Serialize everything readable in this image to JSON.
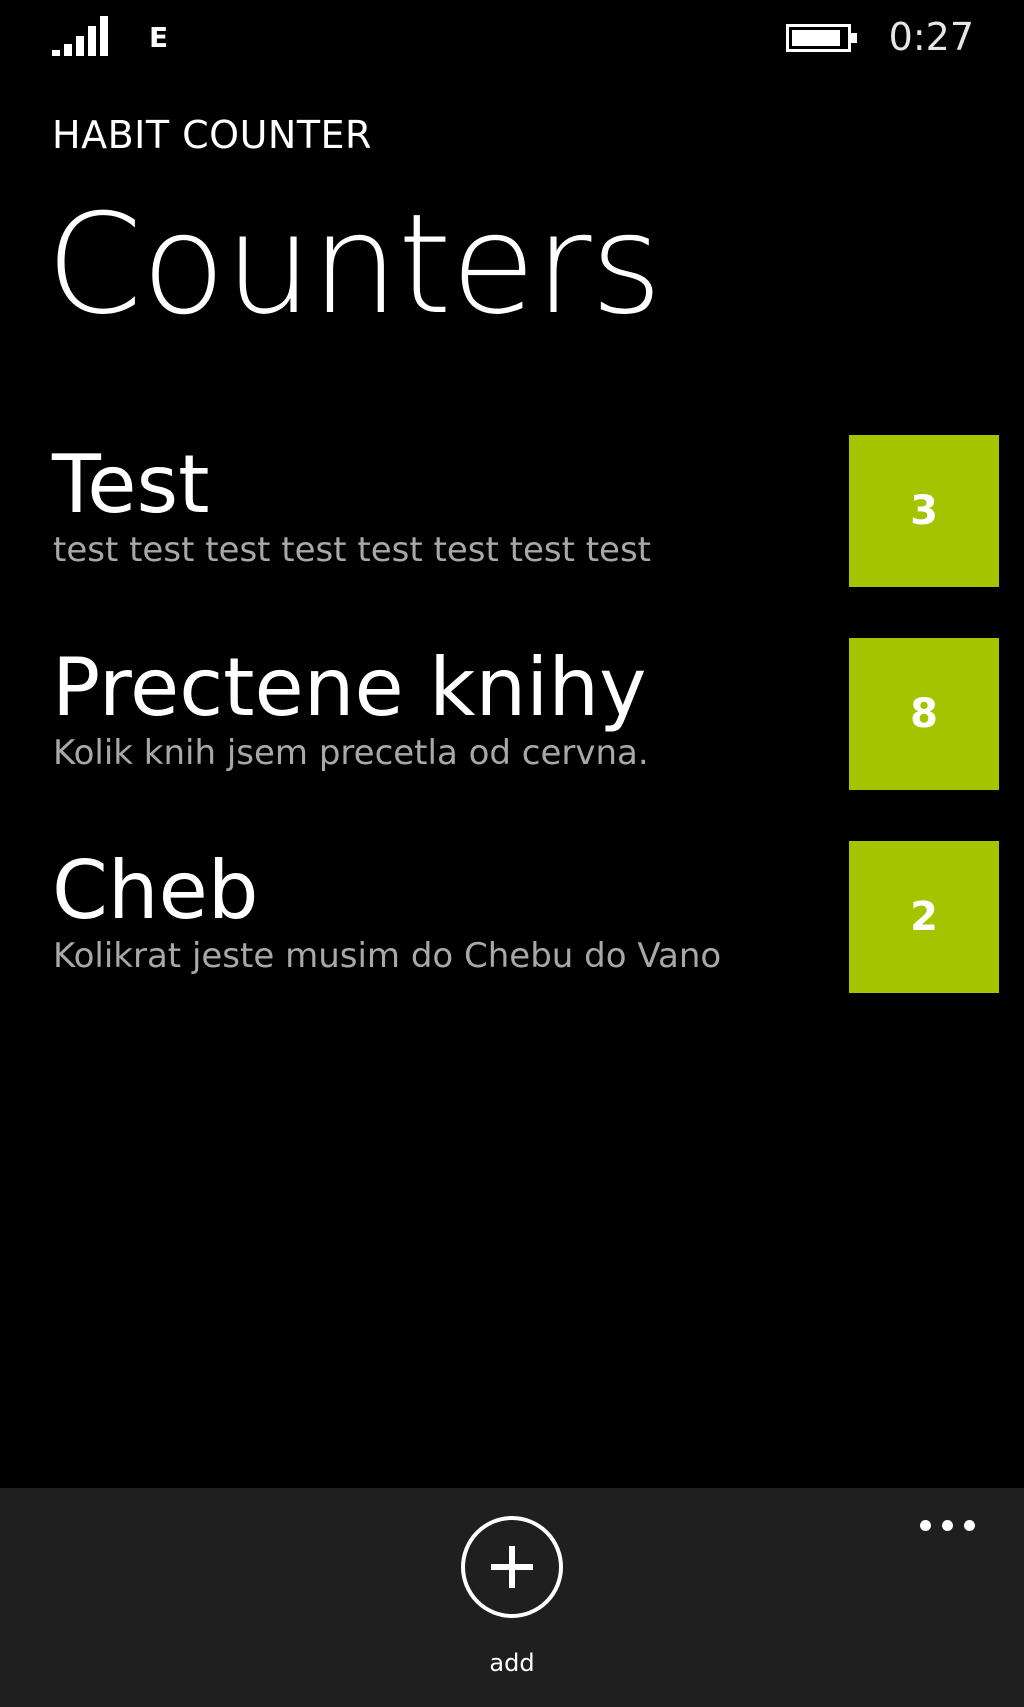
{
  "status_bar": {
    "network": "E",
    "time": "0:27",
    "signal_icon": "signal-bars-icon",
    "battery_icon": "battery-icon"
  },
  "header": {
    "app_title": "HABIT COUNTER",
    "page_title": "Counters"
  },
  "counters": [
    {
      "name": "Test",
      "description": "test test test test test test test test",
      "count": "3"
    },
    {
      "name": "Prectene knihy",
      "description": "Kolik knih jsem precetla od cervna.",
      "count": "8"
    },
    {
      "name": "Cheb",
      "description": "Kolikrat jeste musim do Chebu do Vano",
      "count": "2"
    }
  ],
  "app_bar": {
    "add_label": "add",
    "add_icon": "plus-circle-icon",
    "more_icon": "ellipsis-icon"
  },
  "colors": {
    "accent": "#a4c400",
    "background": "#000000",
    "app_bar": "#1f1f1f",
    "subtle_text": "#a8a8a8"
  }
}
